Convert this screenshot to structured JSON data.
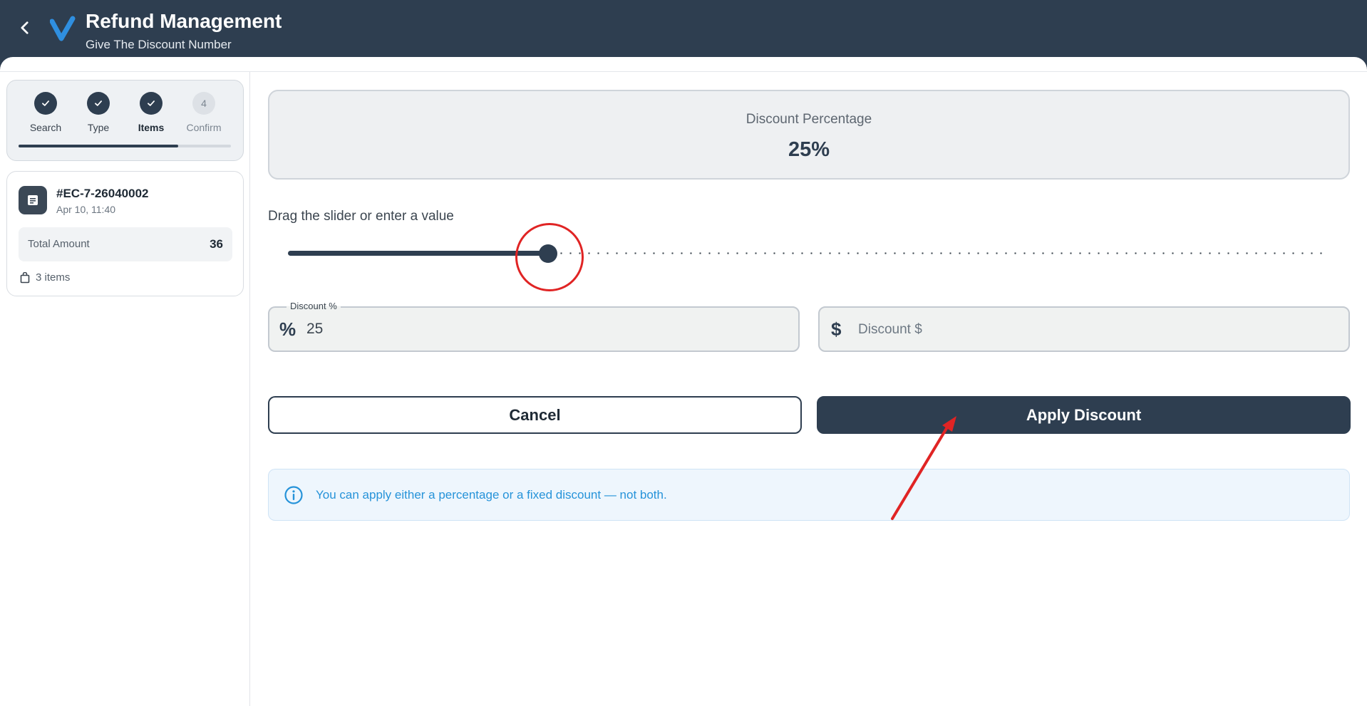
{
  "header": {
    "title": "Refund Management",
    "subtitle": "Give The Discount Number"
  },
  "stepper": {
    "steps": [
      {
        "label": "Search",
        "state": "done"
      },
      {
        "label": "Type",
        "state": "done"
      },
      {
        "label": "Items",
        "state": "active"
      },
      {
        "label": "Confirm",
        "state": "pending",
        "number": "4"
      }
    ],
    "progress_fraction": 0.75
  },
  "order": {
    "id": "#EC-7-26040002",
    "date": "Apr 10, 11:40",
    "total_label": "Total Amount",
    "total_value": "36",
    "items": "3 items"
  },
  "discount": {
    "card_label": "Discount Percentage",
    "card_value": "25%",
    "slider_hint": "Drag the slider or enter a value",
    "slider_value_percent": 25,
    "percent_field": {
      "label": "Discount %",
      "value": "25",
      "prefix": "%"
    },
    "amount_field": {
      "placeholder": "Discount $",
      "prefix": "$"
    }
  },
  "actions": {
    "cancel": "Cancel",
    "apply": "Apply Discount"
  },
  "info": {
    "text": "You can apply either a percentage or a fixed discount — not both."
  },
  "colors": {
    "header_bg": "#2e3e50",
    "accent_blue": "#2693d9",
    "annotation_red": "#e02424"
  }
}
